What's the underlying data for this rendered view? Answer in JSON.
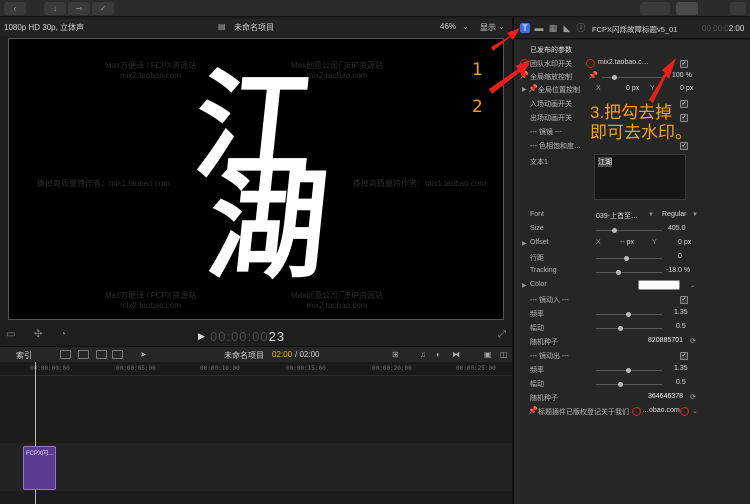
{
  "viewer": {
    "format": "1080p HD 30p, 立体声",
    "project_name": "未命名项目",
    "zoom": "46%",
    "display_menu": "显示",
    "watermarks": [
      {
        "text": "Max方便译 / FCPX资源站\nmix2.taobao.com"
      },
      {
        "text": "Max创意公司门EIP资源站\nmix2.taobao.com"
      },
      {
        "text": "撕掉高质量特作者：mix1.taobao.com"
      },
      {
        "text": "撕掉高质量特作者：mix1.taobao.com"
      },
      {
        "text": "Max方便译 / FCPX资源站\nmix2.taobao.com"
      },
      {
        "text": "Max创意公司门EIP资源站\nmix2.taobao.com"
      }
    ],
    "title_text": [
      "江",
      "湖"
    ],
    "timecode_dim": "00:00:00",
    "timecode_frame": "23"
  },
  "timeline": {
    "index_label": "索引",
    "project_name": "未命名项目",
    "position": "02:00",
    "duration": "/ 02:00",
    "ruler_marks": [
      "00:00:00:00",
      "00:00:05:00",
      "00:00:10:00",
      "00:00:15:00",
      "00:00:20:00",
      "00:00:25:00"
    ],
    "clip_label": "FCPX闪…"
  },
  "inspector": {
    "title": "FCPX闪烁故障标题v5_01",
    "time_dim": "00:00:0",
    "time_bright": "2:00",
    "section_title": "已发布的参数",
    "rows": {
      "watermark_switch": {
        "label": "团队水印开关",
        "value": "mix2.taobao.c…",
        "checked": true
      },
      "global_scale": {
        "label": "全局缩放控制",
        "value": "100 %"
      },
      "global_position": {
        "label": "全局位置控制",
        "x_label": "X",
        "x_value": "0 px",
        "y_label": "Y",
        "y_value": "0 px"
      },
      "intro_anim": {
        "label": "入场动画开关",
        "checked": true
      },
      "outro_anim": {
        "label": "出场动画开关",
        "checked": true
      },
      "mirror_sep": {
        "label": "--- 镜镜 ---"
      },
      "color_sep": {
        "label": "--- 色相饱和度…",
        "checked": true
      },
      "text1": {
        "label": "文本1",
        "value": "江湖"
      },
      "font": {
        "label": "Font",
        "value": "039-上首至…",
        "weight": "Regular"
      },
      "size": {
        "label": "Size",
        "value": "405.0"
      },
      "offset": {
        "label": "Offset",
        "x_label": "X",
        "x_value": "-- px",
        "y_label": "Y",
        "y_value": "0 px"
      },
      "line_spacing": {
        "label": "行距",
        "value": "0"
      },
      "tracking": {
        "label": "Tracking",
        "value": "-18.0 %"
      },
      "color": {
        "label": "Color",
        "value": "#FFFFFF"
      },
      "shake_in": {
        "label": "--- 镜动入 ---",
        "checked": true
      },
      "freq_in": {
        "label": "频率",
        "value": "1.35"
      },
      "amp_in": {
        "label": "幅动",
        "value": "0.5"
      },
      "seed_in": {
        "label": "随机种子",
        "value": "820885701"
      },
      "shake_out": {
        "label": "--- 镜动出 ---",
        "checked": true
      },
      "freq_out": {
        "label": "频率",
        "value": "1.35"
      },
      "amp_out": {
        "label": "幅动",
        "value": "0.5"
      },
      "seed_out": {
        "label": "随机种子",
        "value": "364646378"
      },
      "footer": {
        "label": "标题插件已版权登记关于我们",
        "value": "…obao.com"
      }
    }
  },
  "annotations": {
    "n1": "1",
    "n2": "2",
    "note_line1": "3.把勾去掉",
    "note_line2": "即可去水印。",
    "color": "#F2A21A"
  }
}
